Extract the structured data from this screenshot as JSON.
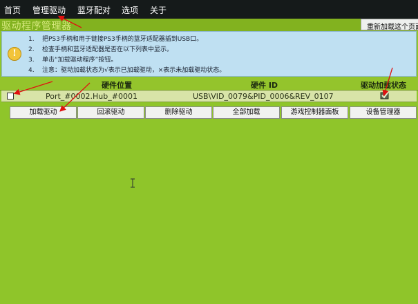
{
  "menu": {
    "items": [
      "首页",
      "管理驱动",
      "蓝牙配对",
      "选项",
      "关于"
    ]
  },
  "header": {
    "title": "驱动程序管理器",
    "reload_button": "重新加载这个页面"
  },
  "info": {
    "icon": "info-icon",
    "lines": [
      {
        "num": "1.",
        "text": "把PS3手柄和用于链接PS3手柄的蓝牙适配器插到USB口。"
      },
      {
        "num": "2.",
        "text": "检查手柄和蓝牙适配器是否在以下列表中显示。"
      },
      {
        "num": "3.",
        "text": "单击“加载驱动程序”按钮。"
      },
      {
        "num": "4.",
        "text": "注意：驱动加载状态为√表示已加载驱动，×表示未加载驱动状态。"
      }
    ]
  },
  "table": {
    "headers": [
      "硬件位置",
      "硬件 ID",
      "驱动加载状态"
    ],
    "rows": [
      {
        "location": "Port_#0002.Hub_#0001",
        "hardware_id": "USB\\VID_0079&PID_0006&REV_0107",
        "status": "loaded"
      }
    ]
  },
  "buttons": [
    "加载驱动",
    "回滚驱动",
    "删除驱动",
    "全部加载",
    "游戏控制器面板",
    "设备管理器"
  ],
  "colors": {
    "background": "#8fc52a",
    "menubar": "#151a1a",
    "info_panel": "#bfe0f2",
    "annotation_arrow": "#e01010"
  }
}
